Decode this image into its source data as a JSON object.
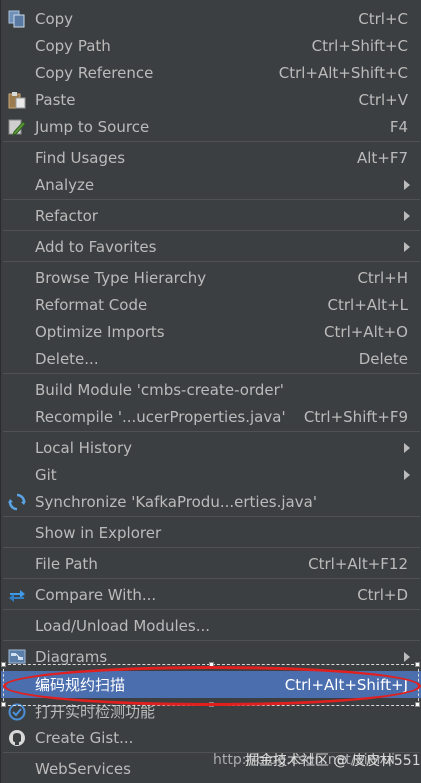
{
  "menu": {
    "copy": {
      "label": "Copy",
      "shortcut": "Ctrl+C"
    },
    "copy_path": {
      "label": "Copy Path",
      "shortcut": "Ctrl+Shift+C"
    },
    "copy_reference": {
      "label": "Copy Reference",
      "shortcut": "Ctrl+Alt+Shift+C"
    },
    "paste": {
      "label": "Paste",
      "shortcut": "Ctrl+V"
    },
    "jump_to_source": {
      "label": "Jump to Source",
      "shortcut": "F4"
    },
    "find_usages": {
      "label": "Find Usages",
      "shortcut": "Alt+F7"
    },
    "analyze": {
      "label": "Analyze"
    },
    "refactor": {
      "label": "Refactor"
    },
    "add_to_favorites": {
      "label": "Add to Favorites"
    },
    "browse_type_hierarchy": {
      "label": "Browse Type Hierarchy",
      "shortcut": "Ctrl+H"
    },
    "reformat_code": {
      "label": "Reformat Code",
      "shortcut": "Ctrl+Alt+L"
    },
    "optimize_imports": {
      "label": "Optimize Imports",
      "shortcut": "Ctrl+Alt+O"
    },
    "delete": {
      "label": "Delete...",
      "shortcut": "Delete"
    },
    "build_module": {
      "label": "Build Module 'cmbs-create-order'"
    },
    "recompile": {
      "label": "Recompile '...ucerProperties.java'",
      "shortcut": "Ctrl+Shift+F9"
    },
    "local_history": {
      "label": "Local History"
    },
    "git": {
      "label": "Git"
    },
    "synchronize": {
      "label": "Synchronize 'KafkaProdu...erties.java'"
    },
    "show_in_explorer": {
      "label": "Show in Explorer"
    },
    "file_path": {
      "label": "File Path",
      "shortcut": "Ctrl+Alt+F12"
    },
    "compare_with": {
      "label": "Compare With...",
      "shortcut": "Ctrl+D"
    },
    "load_unload_modules": {
      "label": "Load/Unload Modules..."
    },
    "diagrams": {
      "label": "Diagrams"
    },
    "code_scan": {
      "label": "编码规约扫描",
      "shortcut": "Ctrl+Alt+Shift+J"
    },
    "realtime_check": {
      "label": "打开实时检测功能"
    },
    "create_gist": {
      "label": "Create Gist..."
    },
    "webservices": {
      "label": "WebServices"
    }
  },
  "watermark": "http://blog.csdn.net/xinrui",
  "watermark_overlay": "掘金技术社区 @ 皮皮林551",
  "colors": {
    "menu_bg": "#3c3f41",
    "text": "#bbbbbb",
    "separator": "#515151",
    "selected_bg": "#4b6eaf",
    "highlight_ellipse": "#e0201f"
  },
  "icons": {
    "copy": "copy-icon",
    "paste": "paste-icon",
    "jump_to_source": "edit-pencil-icon",
    "synchronize": "sync-icon",
    "compare_with": "compare-arrows-icon",
    "diagrams": "diagram-icon",
    "realtime_check": "check-circle-icon",
    "create_gist": "github-icon"
  }
}
